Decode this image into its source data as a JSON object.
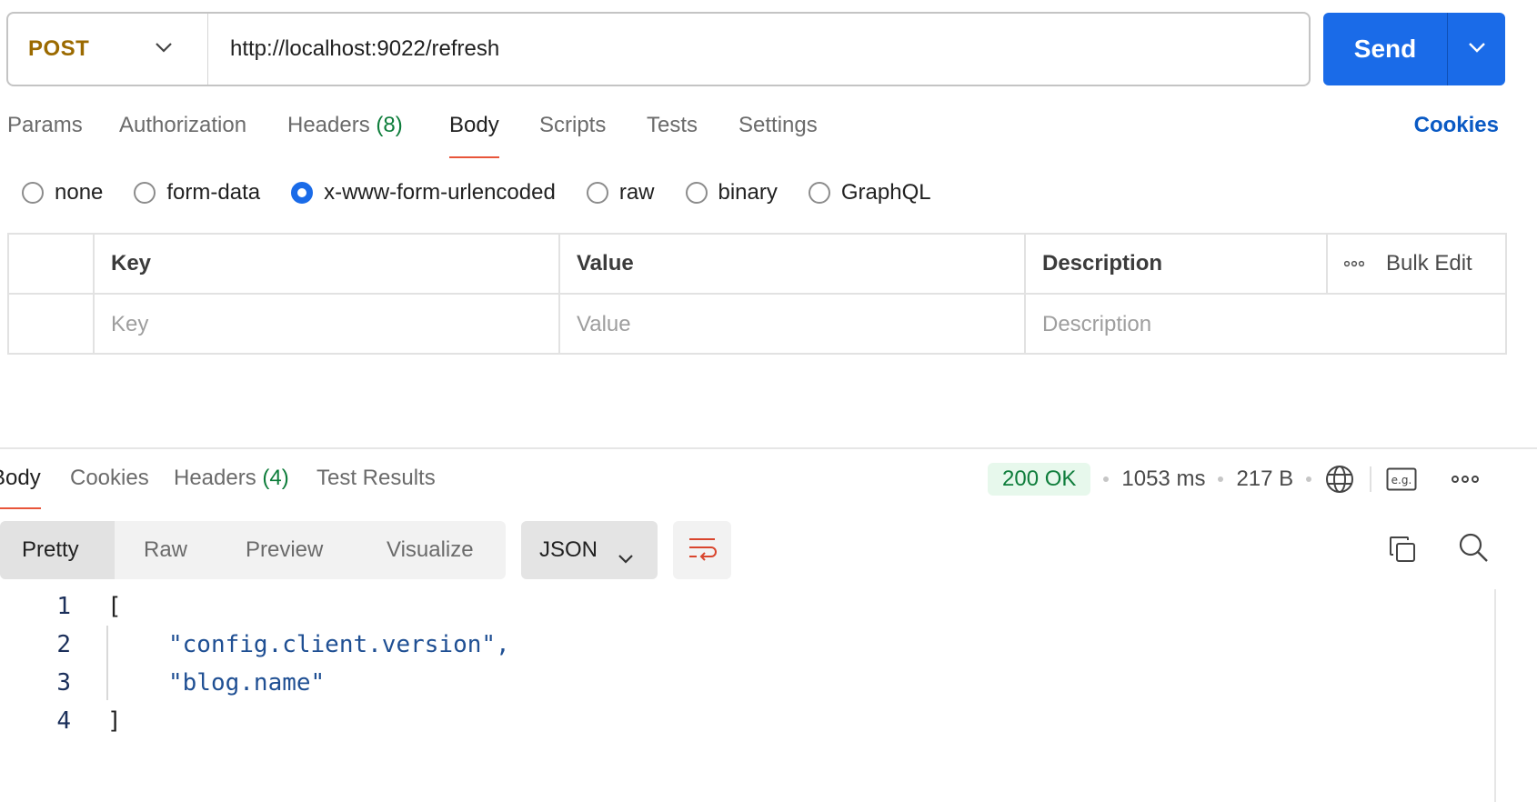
{
  "request": {
    "method": "POST",
    "url": "http://localhost:9022/refresh",
    "send_label": "Send"
  },
  "request_tabs": [
    {
      "label": "Params",
      "count": ""
    },
    {
      "label": "Authorization",
      "count": ""
    },
    {
      "label": "Headers",
      "count": "(8)"
    },
    {
      "label": "Body",
      "count": ""
    },
    {
      "label": "Scripts",
      "count": ""
    },
    {
      "label": "Tests",
      "count": ""
    },
    {
      "label": "Settings",
      "count": ""
    }
  ],
  "active_request_tab": "Body",
  "cookies_label": "Cookies",
  "body_types": [
    {
      "label": "none",
      "selected": false
    },
    {
      "label": "form-data",
      "selected": false
    },
    {
      "label": "x-www-form-urlencoded",
      "selected": true
    },
    {
      "label": "raw",
      "selected": false
    },
    {
      "label": "binary",
      "selected": false
    },
    {
      "label": "GraphQL",
      "selected": false
    }
  ],
  "kv_table": {
    "headers": {
      "key": "Key",
      "value": "Value",
      "description": "Description",
      "bulk_edit": "Bulk Edit"
    },
    "placeholders": {
      "key": "Key",
      "value": "Value",
      "description": "Description"
    }
  },
  "response": {
    "tabs": [
      {
        "label": "Body",
        "count": ""
      },
      {
        "label": "Cookies",
        "count": ""
      },
      {
        "label": "Headers",
        "count": "(4)"
      },
      {
        "label": "Test Results",
        "count": ""
      }
    ],
    "status": "200 OK",
    "time": "1053 ms",
    "size": "217 B",
    "view_modes": [
      "Pretty",
      "Raw",
      "Preview",
      "Visualize"
    ],
    "active_view": "Pretty",
    "format": "JSON",
    "example_label": "e.g.",
    "code_lines": [
      {
        "n": "1",
        "text": "[",
        "kind": "punct",
        "indent": false
      },
      {
        "n": "2",
        "text": "\"config.client.version\",",
        "kind": "str",
        "indent": true
      },
      {
        "n": "3",
        "text": "\"blog.name\"",
        "kind": "str",
        "indent": true
      },
      {
        "n": "4",
        "text": "]",
        "kind": "punct",
        "indent": false
      }
    ]
  },
  "colors": {
    "accent_blue": "#1a6be8",
    "method_post": "#9b6a00",
    "success_green": "#0e7d3b",
    "tab_underline": "#e8553a"
  }
}
